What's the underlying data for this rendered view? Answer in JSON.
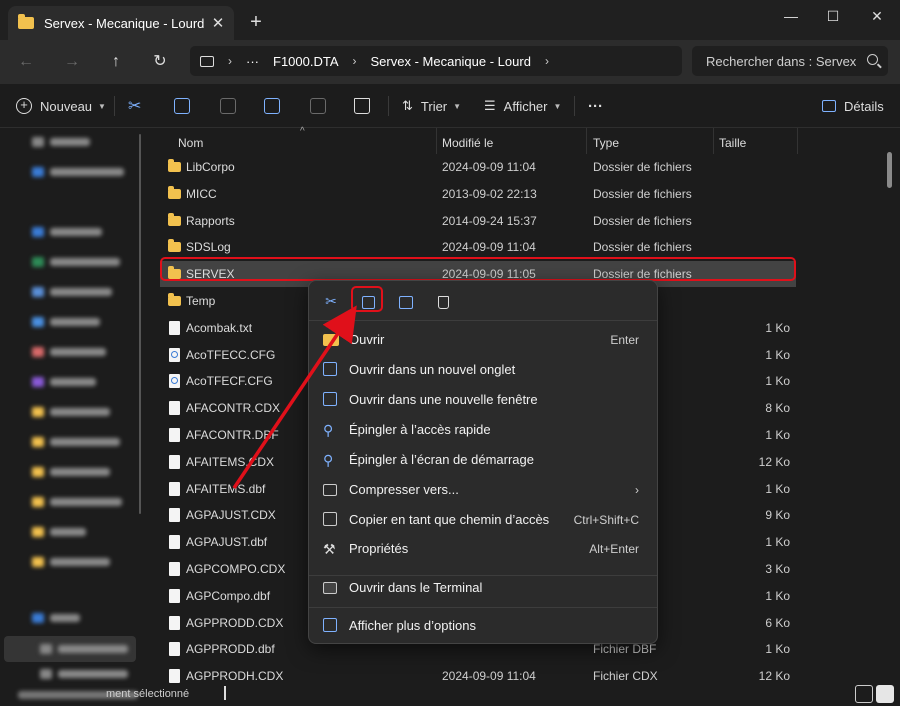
{
  "window": {
    "tab_title": "Servex - Mecanique - Lourd",
    "close_tab": "✕",
    "new_tab": "+",
    "minimize": "—",
    "maximize": "☐",
    "close": "✕"
  },
  "nav": {
    "back": "←",
    "forward": "→",
    "up": "↑",
    "refresh": "↻"
  },
  "address": {
    "ellipsis": "···",
    "crumbs": [
      "F1000.DTA",
      "Servex - Mecanique - Lourd"
    ],
    "sep": "›"
  },
  "search": {
    "placeholder": "Rechercher dans : Servex"
  },
  "toolbar": {
    "new_label": "Nouveau",
    "sort_label": "Trier",
    "view_label": "Afficher",
    "more_label": "···",
    "details_label": "Détails"
  },
  "columns": {
    "name": "Nom",
    "modified": "Modifié le",
    "type": "Type",
    "size": "Taille"
  },
  "files": [
    {
      "name": "LibCorpo",
      "date": "2024-09-09 11:04",
      "type": "Dossier de fichiers",
      "size": "",
      "icon": "folder"
    },
    {
      "name": "MICC",
      "date": "2013-09-02 22:13",
      "type": "Dossier de fichiers",
      "size": "",
      "icon": "folder"
    },
    {
      "name": "Rapports",
      "date": "2014-09-24 15:37",
      "type": "Dossier de fichiers",
      "size": "",
      "icon": "folder"
    },
    {
      "name": "SDSLog",
      "date": "2024-09-09 11:04",
      "type": "Dossier de fichiers",
      "size": "",
      "icon": "folder"
    },
    {
      "name": "SERVEX",
      "date": "2024-09-09 11:05",
      "type": "Dossier de fichiers",
      "size": "",
      "icon": "folder"
    },
    {
      "name": "Temp",
      "date": "",
      "type": "hiers",
      "size": "",
      "icon": "folder"
    },
    {
      "name": "Acombak.txt",
      "date": "",
      "type": "xte",
      "size": "1 Ko",
      "icon": "doc"
    },
    {
      "name": "AcoTFECC.CFG",
      "date": "",
      "type": "e Config...",
      "size": "1 Ko",
      "icon": "cfg"
    },
    {
      "name": "AcoTFECF.CFG",
      "date": "",
      "type": "e Config...",
      "size": "1 Ko",
      "icon": "cfg"
    },
    {
      "name": "AFACONTR.CDX",
      "date": "",
      "type": "",
      "size": "8 Ko",
      "icon": "doc"
    },
    {
      "name": "AFACONTR.DBF",
      "date": "",
      "type": "",
      "size": "1 Ko",
      "icon": "doc"
    },
    {
      "name": "AFAITEMS.CDX",
      "date": "",
      "type": "",
      "size": "12 Ko",
      "icon": "doc"
    },
    {
      "name": "AFAITEMS.dbf",
      "date": "",
      "type": "",
      "size": "1 Ko",
      "icon": "doc"
    },
    {
      "name": "AGPAJUST.CDX",
      "date": "",
      "type": "",
      "size": "9 Ko",
      "icon": "doc"
    },
    {
      "name": "AGPAJUST.dbf",
      "date": "",
      "type": "",
      "size": "1 Ko",
      "icon": "doc"
    },
    {
      "name": "AGPCOMPO.CDX",
      "date": "",
      "type": "",
      "size": "3 Ko",
      "icon": "doc"
    },
    {
      "name": "AGPCompo.dbf",
      "date": "",
      "type": "",
      "size": "1 Ko",
      "icon": "doc"
    },
    {
      "name": "AGPPRODD.CDX",
      "date": "",
      "type": "",
      "size": "6 Ko",
      "icon": "doc"
    },
    {
      "name": "AGPPRODD.dbf",
      "date": "",
      "type": "Fichier DBF",
      "size": "1 Ko",
      "icon": "doc"
    },
    {
      "name": "AGPPRODH.CDX",
      "date": "2024-09-09 11:04",
      "type": "Fichier CDX",
      "size": "12 Ko",
      "icon": "doc"
    }
  ],
  "context_menu": {
    "top_actions": [
      "cut",
      "copy",
      "rename",
      "delete"
    ],
    "items": [
      {
        "label": "Ouvrir",
        "shortcut": "Enter",
        "icon": "folder-open-icon"
      },
      {
        "label": "Ouvrir dans un nouvel onglet",
        "shortcut": "",
        "icon": "new-tab-icon"
      },
      {
        "label": "Ouvrir dans une nouvelle fenêtre",
        "shortcut": "",
        "icon": "new-window-icon"
      },
      {
        "label": "Épingler à l’accès rapide",
        "shortcut": "",
        "icon": "pin-icon"
      },
      {
        "label": "Épingler à l’écran de démarrage",
        "shortcut": "",
        "icon": "pin-start-icon"
      },
      {
        "label": "Compresser vers...",
        "shortcut": "›",
        "icon": "archive-icon"
      },
      {
        "label": "Copier en tant que chemin d’accès",
        "shortcut": "Ctrl+Shift+C",
        "icon": "copy-path-icon"
      },
      {
        "label": "Propriétés",
        "shortcut": "Alt+Enter",
        "icon": "wrench-icon"
      },
      {
        "label": "Ouvrir dans le Terminal",
        "shortcut": "",
        "icon": "terminal-icon"
      },
      {
        "label": "Afficher plus d’options",
        "shortcut": "",
        "icon": "more-options-icon"
      }
    ]
  },
  "status": {
    "text": "ment sélectionné"
  },
  "colors": {
    "accent": "#7fb2ff",
    "highlight": "#e0101a",
    "folder": "#f2c14e",
    "selection": "#434343"
  }
}
